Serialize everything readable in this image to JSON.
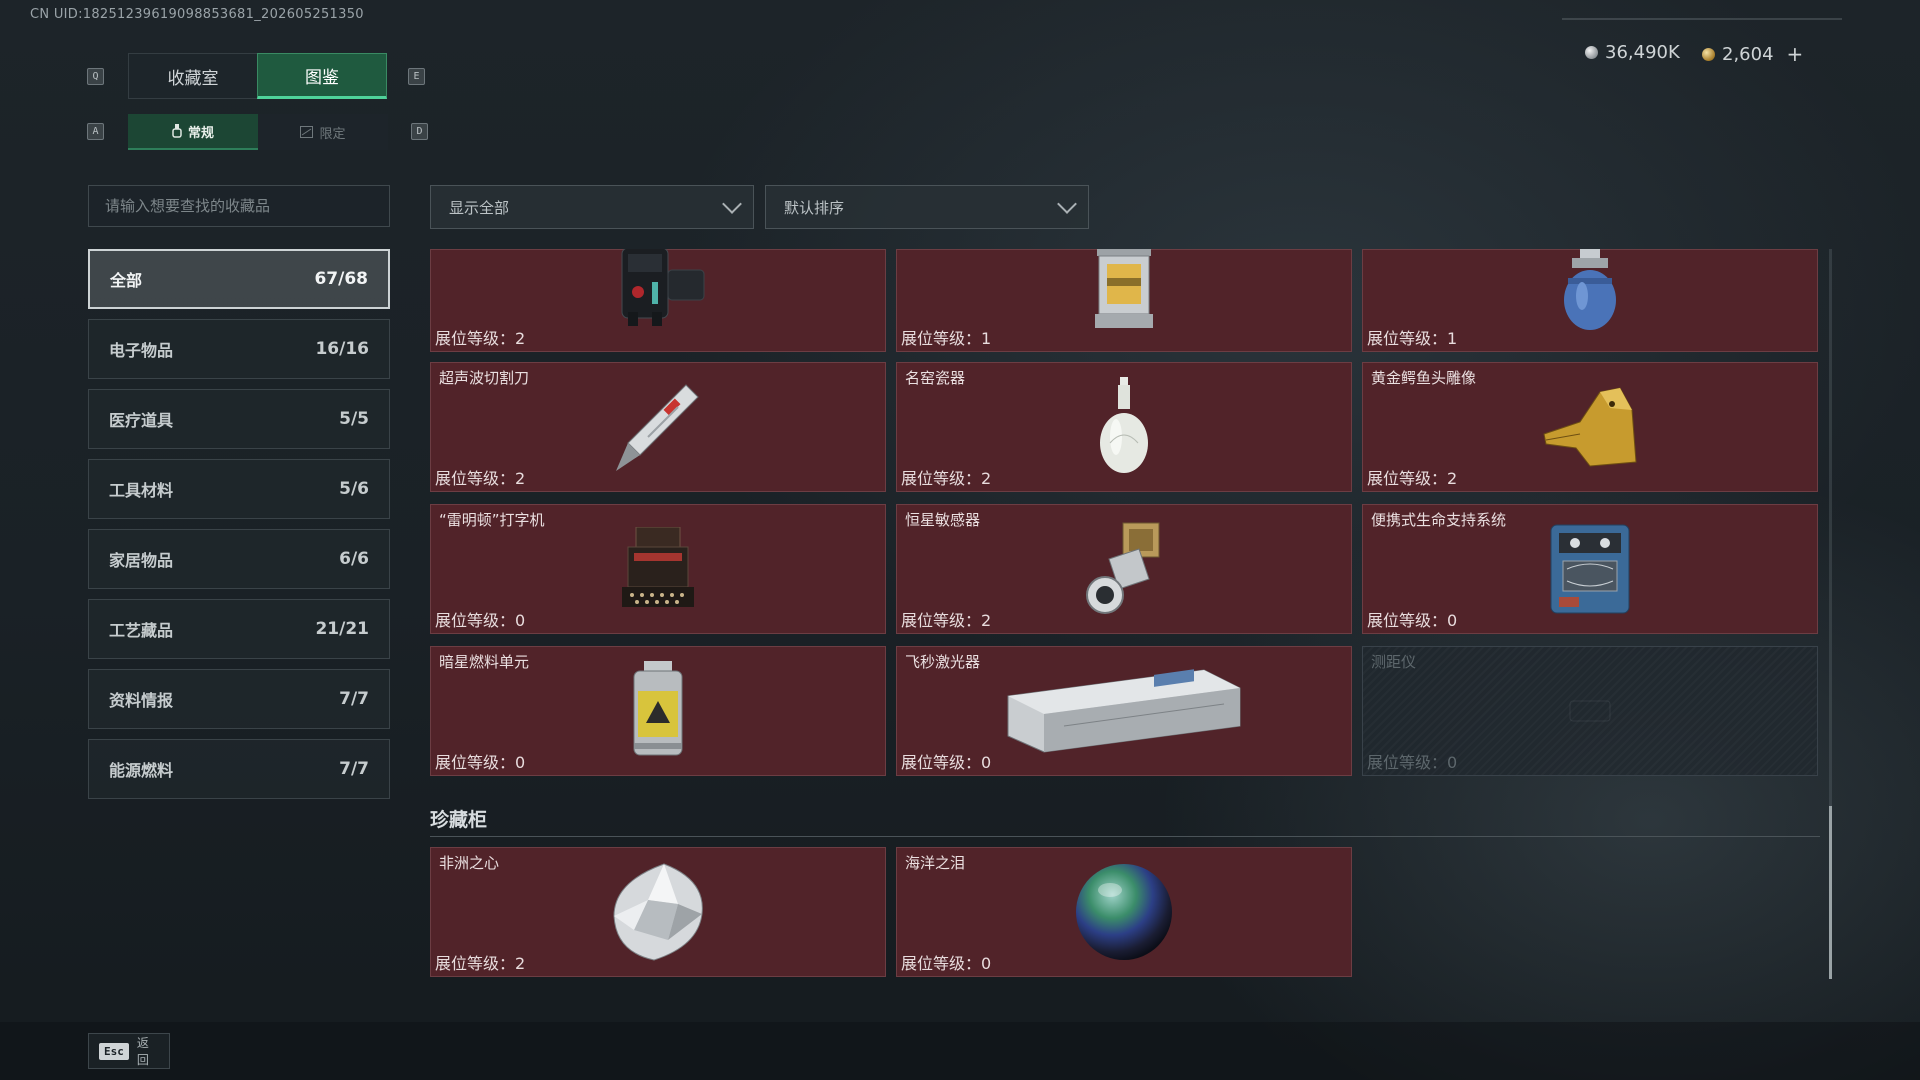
{
  "uid": "CN UID:18251239619098853681_202605251350",
  "currency": {
    "silver": "36,490K",
    "gold": "2,604",
    "plus": "+"
  },
  "hotkeys": {
    "prev_tab": "Q",
    "next_tab": "E",
    "prev_sub": "A",
    "next_sub": "D"
  },
  "tabs": [
    {
      "label": "收藏室",
      "active": false
    },
    {
      "label": "图鉴",
      "active": true
    }
  ],
  "subtabs": [
    {
      "label": "常规",
      "active": true
    },
    {
      "label": "限定",
      "active": false
    }
  ],
  "search": {
    "placeholder": "请输入想要查找的收藏品"
  },
  "filters": {
    "show": "显示全部",
    "sort": "默认排序"
  },
  "categories": [
    {
      "label": "全部",
      "count": "67/68",
      "active": true
    },
    {
      "label": "电子物品",
      "count": "16/16"
    },
    {
      "label": "医疗道具",
      "count": "5/5"
    },
    {
      "label": "工具材料",
      "count": "5/6"
    },
    {
      "label": "家居物品",
      "count": "6/6"
    },
    {
      "label": "工艺藏品",
      "count": "21/21"
    },
    {
      "label": "资料情报",
      "count": "7/7"
    },
    {
      "label": "能源燃料",
      "count": "7/7"
    }
  ],
  "level_label": "展位等级：",
  "items": [
    {
      "name": "",
      "level": "2",
      "icon": "device-icon"
    },
    {
      "name": "",
      "level": "1",
      "icon": "lantern-icon"
    },
    {
      "name": "",
      "level": "1",
      "icon": "gas-canister-icon"
    },
    {
      "name": "超声波切割刀",
      "level": "2",
      "icon": "cutter-knife-icon"
    },
    {
      "name": "名窑瓷器",
      "level": "2",
      "icon": "porcelain-vase-icon"
    },
    {
      "name": "黄金鳄鱼头雕像",
      "level": "2",
      "icon": "gold-crocodile-icon"
    },
    {
      "name": "“雷明顿”打字机",
      "level": "0",
      "icon": "typewriter-icon"
    },
    {
      "name": "恒星敏感器",
      "level": "2",
      "icon": "star-sensor-icon"
    },
    {
      "name": "便携式生命支持系统",
      "level": "0",
      "icon": "life-support-icon"
    },
    {
      "name": "暗星燃料单元",
      "level": "0",
      "icon": "fuel-cell-icon"
    },
    {
      "name": "飞秒激光器",
      "level": "0",
      "icon": "laser-case-icon"
    },
    {
      "name": "测距仪",
      "level": "0",
      "icon": "rangefinder-icon",
      "locked": true
    }
  ],
  "cabinet": {
    "title": "珍藏柜",
    "items": [
      {
        "name": "非洲之心",
        "level": "2",
        "icon": "diamond-icon"
      },
      {
        "name": "海洋之泪",
        "level": "0",
        "icon": "pearl-icon"
      }
    ]
  },
  "footer": {
    "esc_key": "Esc",
    "back_label": "返回"
  }
}
